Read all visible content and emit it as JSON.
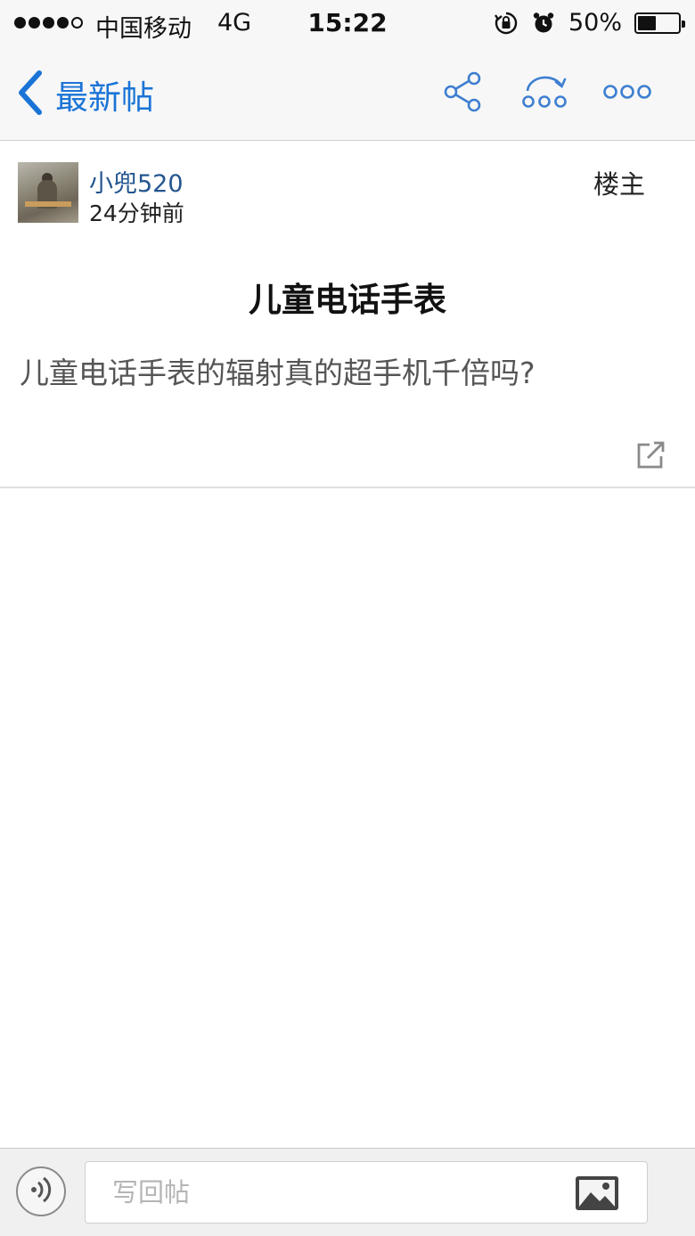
{
  "status_bar": {
    "carrier": "中国移动",
    "network": "4G",
    "time": "15:22",
    "battery_percent": "50%",
    "battery_level": 0.5,
    "signal_strength": 4,
    "signal_max": 5,
    "icons": [
      "orientation-lock-icon",
      "alarm-icon",
      "battery-icon"
    ]
  },
  "nav": {
    "back_label": "最新帖",
    "icons": [
      "back-chevron-icon",
      "share-icon",
      "jump-floor-icon",
      "more-icon"
    ],
    "accent_color": "#1a74d6"
  },
  "post": {
    "author": "小兜520",
    "time": "24分钟前",
    "floor": "楼主",
    "title": "儿童电话手表",
    "body": "儿童电话手表的辐射真的超手机千倍吗?"
  },
  "reply_bar": {
    "placeholder": "写回帖",
    "icons": [
      "voice-icon",
      "image-icon"
    ]
  }
}
